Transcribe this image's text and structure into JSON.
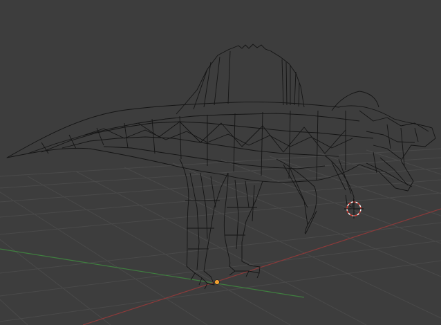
{
  "viewport": {
    "mode": "3d-viewport",
    "shading": "wireframe",
    "background_color": "#3d3d3d",
    "grid_color": "#4a4a4a",
    "x_axis_color": "#8c3a3a",
    "y_axis_color": "#3f7f3f",
    "wire_color": "#111111",
    "cursor_color": "#d9382f",
    "origin_color": "#f0a030"
  },
  "scene": {
    "object": "spinosaurus-wireframe-mesh",
    "icons": [
      "3d-cursor-icon",
      "object-origin-icon"
    ]
  }
}
